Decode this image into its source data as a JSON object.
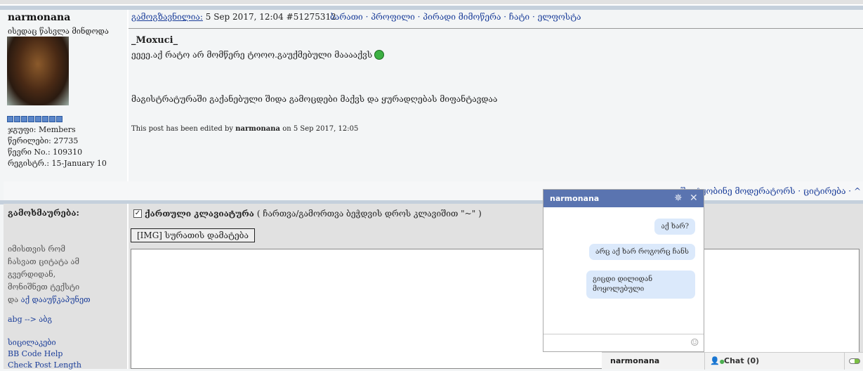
{
  "post": {
    "author": "narmonana",
    "author_title": "ისედაც წასვლა მინდოდა",
    "group": "ჯგუფი: Members",
    "posts": "წერილები: 27735",
    "member_no": "წევრი No.: 109310",
    "registered": "რეგისტრ.: 15-January 10",
    "sent_label": "გამოგზავნილია:",
    "date": "5 Sep 2017, 12:04",
    "post_id": "#51275312",
    "nav_links": "ბარათი · პროფილი · პირადი მიმოწერა · ჩატი · ელფოსტა",
    "quote_user": "_Moxuci_",
    "line1": "ეეეე.აქ რატო არ მომწერე ტოოო.გაუქმებული მააააქვს",
    "line2": "მაგისტრატურაში გაქანებული შიდა გამოცდები მაქვს და ყურადღებას მიფანტავდაა",
    "edited_prefix": "This post has been edited by",
    "edited_user": "narmonana",
    "edited_suffix": "on 5 Sep 2017, 12:05",
    "footer_links": "შეატყობინე მოდერატორს  · ციტირება · ^"
  },
  "reply": {
    "label": "გამოხმაურება:",
    "hint": "იმისთვის რომ ჩასვათ ციტატა ამ გვერდიდან, მონიშნეთ ტექსტი და",
    "hint_link": "აქ დააუწკაპუნეთ",
    "translit": "abg --> აბგ",
    "links": [
      "სიცილაკები",
      "BB Code Help",
      "Check Post Length"
    ],
    "keyboard_label": "ქართული კლავიატურა",
    "keyboard_note": "( ჩართვა/გამორთვა ბეჭდვის დროს კლავიშით \"~\" )",
    "img_button": "[IMG] სურათის დამატება"
  },
  "chat": {
    "title": "narmonana",
    "messages": [
      "აქ ხარ?",
      "არც აქ ხარ როგორც ჩანს",
      "გიცდი დილიდან მოყოლებული"
    ],
    "tab_user": "narmonana",
    "chat_label": "Chat",
    "chat_count": "(0)"
  }
}
